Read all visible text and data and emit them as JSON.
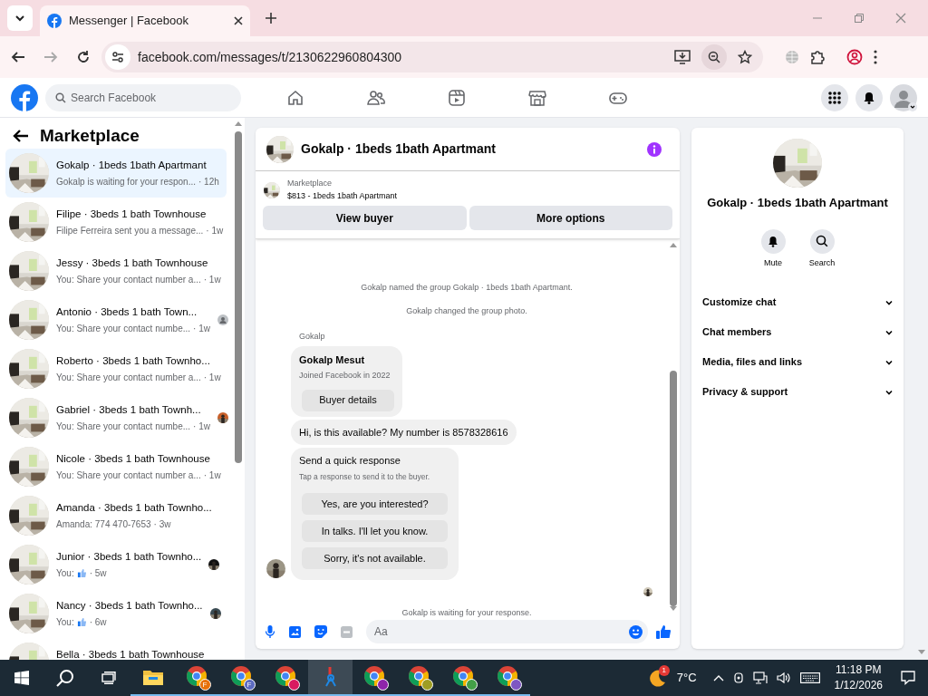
{
  "browser": {
    "tab_title": "Messenger | Facebook",
    "url": "facebook.com/messages/t/2130622960804300"
  },
  "header": {
    "search_placeholder": "Search Facebook",
    "nav": [
      {
        "kind": "home"
      },
      {
        "kind": "friends"
      },
      {
        "kind": "video"
      },
      {
        "kind": "marketplace"
      },
      {
        "kind": "gaming"
      }
    ]
  },
  "sidebar": {
    "title": "Marketplace",
    "conversations": [
      {
        "title": "Gokalp · 1beds 1bath Apartmant",
        "preview": "Gokalp is waiting for your respon...",
        "time": "· 12h",
        "like": false,
        "selected": true
      },
      {
        "title": "Filipe · 3beds 1 bath Townhouse",
        "preview": "Filipe Ferreira sent you a message...",
        "time": "· 1w",
        "like": false,
        "selected": false
      },
      {
        "title": "Jessy · 3beds 1 bath Townhouse",
        "preview": "You: Share your contact number a...",
        "time": "· 1w",
        "like": false,
        "selected": false
      },
      {
        "title": "Antonio · 3beds 1 bath Town...",
        "preview": "You: Share your contact numbe...",
        "time": "· 1w",
        "like": false,
        "receipt": {
          "kind": "silhouette"
        },
        "selected": false
      },
      {
        "title": "Roberto · 3beds 1 bath Townho...",
        "preview": "You: Share your contact number a...",
        "time": "· 1w",
        "like": false,
        "selected": false
      },
      {
        "title": "Gabriel · 3beds 1 bath Townh...",
        "preview": "You: Share your contact numbe...",
        "time": "· 1w",
        "like": false,
        "selected": false
      },
      {
        "title": "Nicole · 3beds 1 bath Townhouse",
        "preview": "You: Share your contact number a...",
        "time": "· 1w",
        "like": false,
        "selected": false
      },
      {
        "title": "Amanda · 3beds 1 bath Townho...",
        "preview": "Amanda: 774 470-7653",
        "time": "· 3w",
        "like": false,
        "selected": false
      },
      {
        "title": "Junior · 3beds 1 bath Townho...",
        "preview": "You:",
        "time": "· 5w",
        "like": true,
        "selected": false
      },
      {
        "title": "Nancy · 3beds 1 bath Townho...",
        "preview": "You:",
        "time": "· 6w",
        "like": true,
        "selected": false
      },
      {
        "title": "Bella · 3beds 1 bath Townhouse",
        "selected": false
      }
    ]
  },
  "chat": {
    "title": "Gokalp · 1beds 1bath Apartmant",
    "listing": {
      "label": "Marketplace",
      "title": "$813 - 1beds 1bath Apartmant"
    },
    "buttons": [
      "View buyer",
      "More options"
    ],
    "events": [
      "Gokalp named the group Gokalp · 1beds 1bath Apartmant.",
      "Gokalp changed the group photo."
    ],
    "sender": "Gokalp",
    "profile": {
      "name": "Gokalp Mesut",
      "subtitle": "Joined Facebook in 2022",
      "button": "Buyer details"
    },
    "message": "Hi, is this available? My number is 8578328616",
    "quick_response": {
      "title": "Send a quick response",
      "subtitle": "Tap a response to send it to the buyer.",
      "options": [
        "Yes, are you interested?",
        "In talks. I'll let you know.",
        "Sorry, it's not available."
      ]
    },
    "status": "Gokalp is waiting for your response.",
    "composer_placeholder": "Aa"
  },
  "details": {
    "title": "Gokalp · 1beds 1bath Apartmant",
    "actions": [
      {
        "kind": "mute",
        "label": "Mute"
      },
      {
        "kind": "search",
        "label": "Search"
      }
    ],
    "sections": [
      {
        "label": "Customize chat",
        "expanded": false
      },
      {
        "label": "Chat members",
        "expanded": false
      },
      {
        "label": "Media, files and links",
        "expanded": false
      },
      {
        "label": "Privacy & support",
        "expanded": false
      }
    ]
  },
  "taskbar": {
    "apps": [
      {
        "kind": "explorer",
        "selected": false
      },
      {
        "kind": "chrome",
        "badge": "F",
        "color": "#e8710a",
        "selected": false
      },
      {
        "kind": "chrome",
        "badge": "F",
        "color": "#5c6bc0",
        "selected": false
      },
      {
        "kind": "chrome",
        "color": "#d81b60",
        "selected": false
      },
      {
        "kind": "tool",
        "selected": true
      },
      {
        "kind": "chrome",
        "color": "#8e24aa",
        "selected": false
      },
      {
        "kind": "chrome",
        "color": "#9e9d24",
        "selected": false
      },
      {
        "kind": "chrome",
        "color": "#43a047",
        "selected": false
      },
      {
        "kind": "chrome",
        "color": "#7e57c2",
        "selected": false
      }
    ],
    "weather_badge": "1",
    "temperature": "7°C",
    "time": "11:18 PM",
    "date": "1/12/2026"
  }
}
